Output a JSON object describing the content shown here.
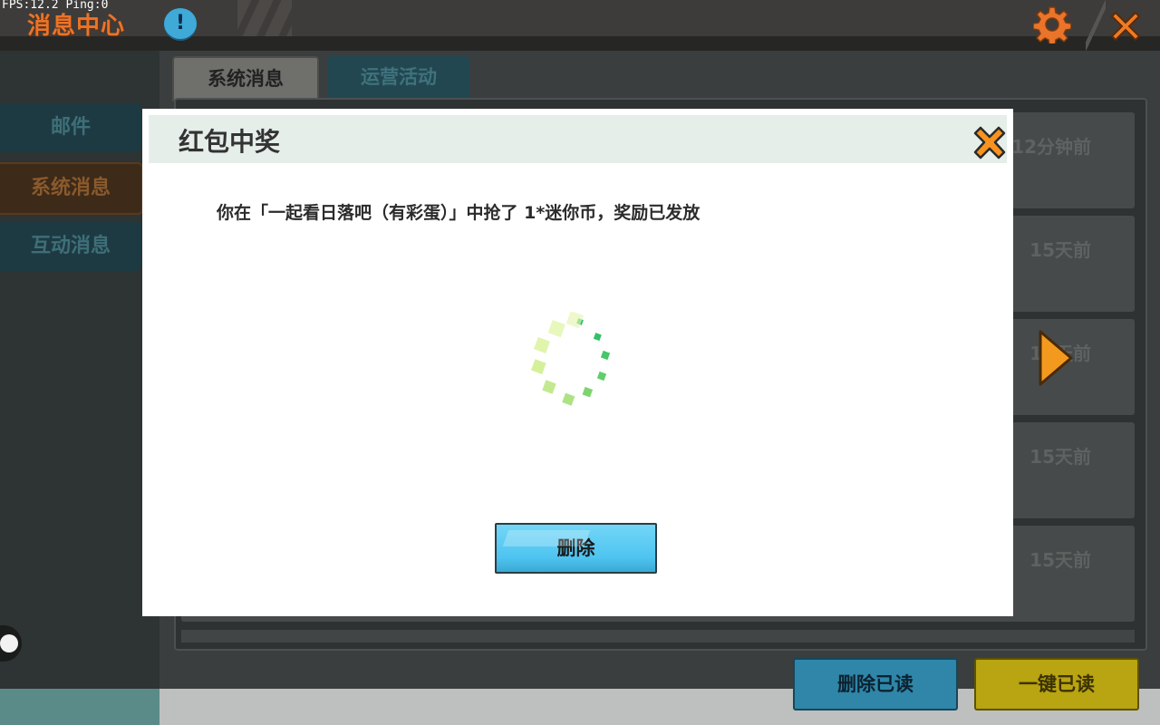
{
  "debug": {
    "fps_text": "FPS:12.2  Ping:0"
  },
  "header": {
    "title": "消息中心",
    "alert_icon": "alert-info-icon",
    "alert_glyph": "!",
    "settings_icon": "gear-icon",
    "close_icon": "close-icon"
  },
  "sidebar": {
    "items": [
      {
        "label": "邮件"
      },
      {
        "label": "系统消息",
        "active": true
      },
      {
        "label": "互动消息"
      }
    ]
  },
  "tabs": [
    {
      "label": "系统消息",
      "active": true
    },
    {
      "label": "运营活动"
    }
  ],
  "messages": [
    {
      "time": "12分钟前"
    },
    {
      "time": "15天前"
    },
    {
      "time": "15天前"
    },
    {
      "time": "15天前"
    },
    {
      "time": "15天前"
    }
  ],
  "actions": {
    "delete_read": "删除已读",
    "mark_all_read": "一键已读"
  },
  "modal": {
    "title": "红包中奖",
    "message": "你在「一起看日落吧（有彩蛋）」中抢了 1*迷你币，奖励已发放",
    "delete_button": "删除",
    "loading_icon": "loading-spinner-icon"
  },
  "colors": {
    "accent_orange": "#e9742a",
    "button_blue": "#4ec4f0",
    "button_yellow": "#f5e000"
  }
}
